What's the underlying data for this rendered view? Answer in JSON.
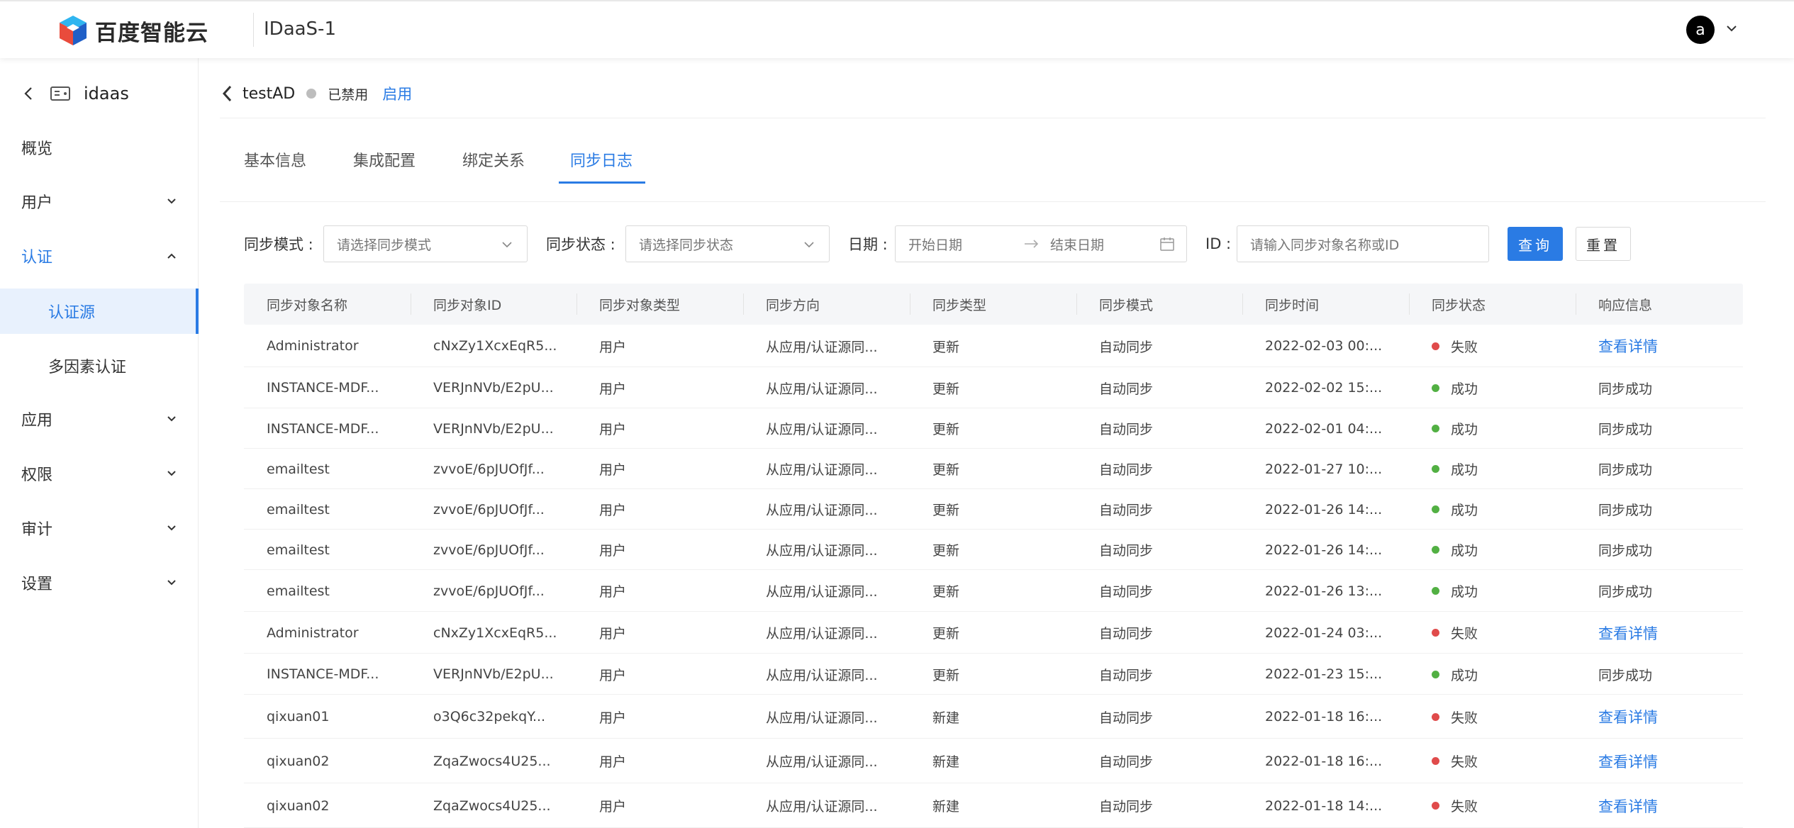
{
  "header": {
    "logo_text": "百度智能云",
    "app_title": "IDaaS-1",
    "avatar_letter": "a"
  },
  "sidebar": {
    "top_label": "idaas",
    "items": [
      {
        "label": "概览"
      },
      {
        "label": "用户"
      },
      {
        "label": "认证"
      },
      {
        "label": "认证源"
      },
      {
        "label": "多因素认证"
      },
      {
        "label": "应用"
      },
      {
        "label": "权限"
      },
      {
        "label": "审计"
      },
      {
        "label": "设置"
      }
    ]
  },
  "breadcrumb": {
    "name": "testAD",
    "status": "已禁用",
    "action": "启用"
  },
  "tabs": [
    {
      "label": "基本信息"
    },
    {
      "label": "集成配置"
    },
    {
      "label": "绑定关系"
    },
    {
      "label": "同步日志"
    }
  ],
  "filters": {
    "mode_label": "同步模式 :",
    "mode_placeholder": "请选择同步模式",
    "status_label": "同步状态 :",
    "status_placeholder": "请选择同步状态",
    "date_label": "日期 :",
    "start_placeholder": "开始日期",
    "end_placeholder": "结束日期",
    "id_label": "ID :",
    "id_placeholder": "请输入同步对象名称或ID",
    "query_label": "查询",
    "reset_label": "重置"
  },
  "table": {
    "columns": [
      "同步对象名称",
      "同步对象ID",
      "同步对象类型",
      "同步方向",
      "同步类型",
      "同步模式",
      "同步时间",
      "同步状态",
      "响应信息"
    ],
    "rows": [
      [
        "Administrator",
        "cNxZy1XcxEqR5...",
        "用户",
        "从应用/认证源同...",
        "更新",
        "自动同步",
        "2022-02-03 00:...",
        "失败",
        "查看详情"
      ],
      [
        "INSTANCE-MDF...",
        "VERJnNVb/E2pU...",
        "用户",
        "从应用/认证源同...",
        "更新",
        "自动同步",
        "2022-02-02 15:...",
        "成功",
        "同步成功"
      ],
      [
        "INSTANCE-MDF...",
        "VERJnNVb/E2pU...",
        "用户",
        "从应用/认证源同...",
        "更新",
        "自动同步",
        "2022-02-01 04:...",
        "成功",
        "同步成功"
      ],
      [
        "emailtest",
        "zvvoE/6pJUOfJf...",
        "用户",
        "从应用/认证源同...",
        "更新",
        "自动同步",
        "2022-01-27 10:...",
        "成功",
        "同步成功"
      ],
      [
        "emailtest",
        "zvvoE/6pJUOfJf...",
        "用户",
        "从应用/认证源同...",
        "更新",
        "自动同步",
        "2022-01-26 14:...",
        "成功",
        "同步成功"
      ],
      [
        "emailtest",
        "zvvoE/6pJUOfJf...",
        "用户",
        "从应用/认证源同...",
        "更新",
        "自动同步",
        "2022-01-26 14:...",
        "成功",
        "同步成功"
      ],
      [
        "emailtest",
        "zvvoE/6pJUOfJf...",
        "用户",
        "从应用/认证源同...",
        "更新",
        "自动同步",
        "2022-01-26 13:...",
        "成功",
        "同步成功"
      ],
      [
        "Administrator",
        "cNxZy1XcxEqR5...",
        "用户",
        "从应用/认证源同...",
        "更新",
        "自动同步",
        "2022-01-24 03:...",
        "失败",
        "查看详情"
      ],
      [
        "INSTANCE-MDF...",
        "VERJnNVb/E2pU...",
        "用户",
        "从应用/认证源同...",
        "更新",
        "自动同步",
        "2022-01-23 15:...",
        "成功",
        "同步成功"
      ],
      [
        "qixuan01",
        "o3Q6c32pekqY...",
        "用户",
        "从应用/认证源同...",
        "新建",
        "自动同步",
        "2022-01-18 16:...",
        "失败",
        "查看详情"
      ],
      [
        "qixuan02",
        "ZqaZwocs4U25...",
        "用户",
        "从应用/认证源同...",
        "新建",
        "自动同步",
        "2022-01-18 16:...",
        "失败",
        "查看详情"
      ],
      [
        "qixuan02",
        "ZqaZwocs4U25...",
        "用户",
        "从应用/认证源同...",
        "新建",
        "自动同步",
        "2022-01-18 14:...",
        "失败",
        "查看详情"
      ]
    ]
  },
  "colors": {
    "accent": "#2a7be4",
    "success": "#52b043",
    "fail": "#e04b4b"
  }
}
